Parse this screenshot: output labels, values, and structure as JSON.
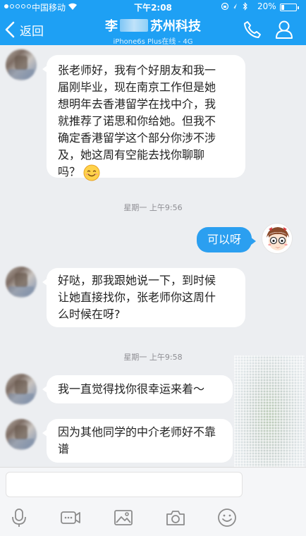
{
  "status_bar": {
    "carrier": "中国移动",
    "time": "下午2:08",
    "battery_percent_text": "20%",
    "battery_level": 0.2
  },
  "header": {
    "back_label": "返回",
    "title_left": "李",
    "title_right": "苏州科技",
    "subtitle": "iPhone6s Plus在线 - 4G"
  },
  "messages": {
    "m1": {
      "sender": "contact",
      "lines": [
        "张老师好，我有个好朋友和我一",
        "届刚毕业，现在南京工作但是她",
        "想明年去香港留学在找中介，我",
        "就推荐了诺思和你给她。但我不",
        "确定香港留学这个部分你涉不涉",
        "及，她这周有空能去找你聊聊",
        "吗？"
      ],
      "emoji": "smile-emoji"
    },
    "t1": "星期一 上午9:56",
    "m2": {
      "sender": "me",
      "text": "可以呀"
    },
    "m3": {
      "sender": "contact",
      "lines": [
        "好哒，那我跟她说一下，到时候",
        "让她直接找你，张老师你这周什",
        "么时候在呀?"
      ]
    },
    "t2": "星期一 上午9:58",
    "m4": {
      "sender": "contact",
      "text": "我一直觉得找你很幸运来着～"
    },
    "m5": {
      "sender": "contact",
      "lines": [
        "因为其他同学的中介老师好不靠",
        "谱"
      ]
    }
  },
  "input": {
    "value": "",
    "placeholder": ""
  },
  "toolbar": [
    "microphone-icon",
    "video-icon",
    "image-icon",
    "camera-icon",
    "emoji-icon"
  ],
  "colors": {
    "header": "#1ea0f4",
    "my_bubble": "#2b9ff0",
    "chat_bg": "#eceef1"
  }
}
